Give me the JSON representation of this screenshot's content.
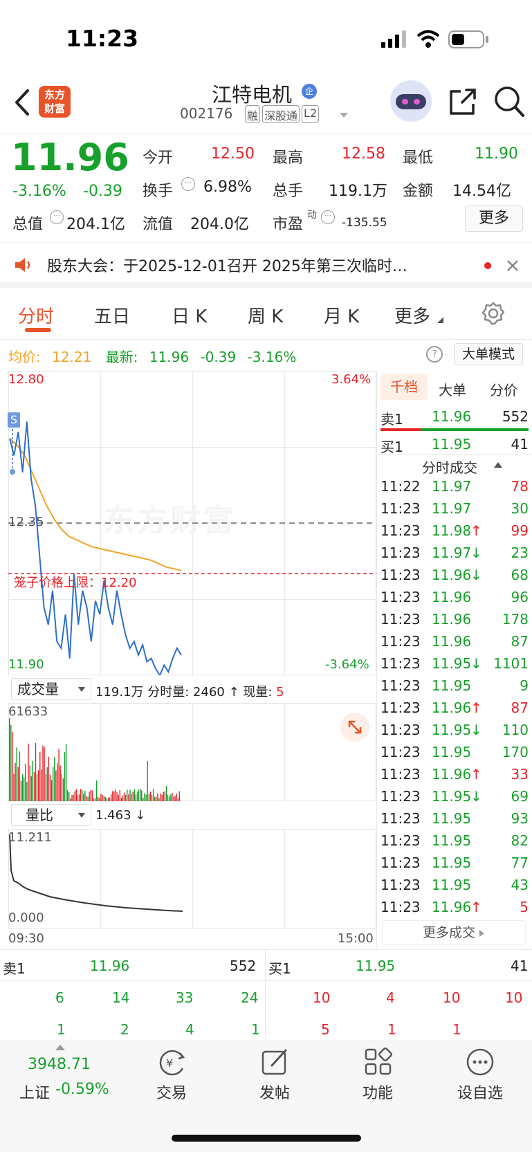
{
  "status": {
    "time": "11:23"
  },
  "header": {
    "stock_name": "江特电机",
    "stock_code": "002176",
    "badges": [
      "融",
      "深股通",
      "L2"
    ],
    "logo_line1": "东方",
    "logo_line2": "财富",
    "verified_icon": "企"
  },
  "quote": {
    "price": "11.96",
    "change_pct": "-3.16%",
    "change": "-0.39",
    "open_label": "今开",
    "open": "12.50",
    "high_label": "最高",
    "high": "12.58",
    "low_label": "最低",
    "low": "11.90",
    "turnover_label": "换手",
    "turnover": "6.98%",
    "volume_label": "总手",
    "volume": "119.1万",
    "amount_label": "金额",
    "amount": "14.54亿",
    "mktcap_label": "总值",
    "mktcap": "204.1亿",
    "float_label": "流值",
    "float": "204.0亿",
    "pe_label": "市盈",
    "pe_sup": "动",
    "pe": "-135.55",
    "more_button": "更多"
  },
  "notice": {
    "text": "股东大会：于2025-12-01召开 2025年第三次临时…"
  },
  "tabs": [
    "分时",
    "五日",
    "日 K",
    "周 K",
    "月 K",
    "更多"
  ],
  "info_line": {
    "avg_label": "均价:",
    "avg": "12.21",
    "latest_label": "最新:",
    "latest": "11.96",
    "chg": "-0.39",
    "pct": "-3.16%",
    "mode_button": "大单模式"
  },
  "chart_labels": {
    "price_top": "12.80",
    "price_mid": "12.35",
    "price_bottom": "11.90",
    "pct_top": "3.64%",
    "pct_bottom": "-3.64%",
    "s_marker": "S",
    "watermark": "东方财富",
    "limit_label": "笼子价格上限：12.20",
    "vol_select": "成交量",
    "vol_summary": "119.1万 分时量: 2460 ↑ 现量:",
    "vol_now": "5",
    "vol_max": "61633",
    "ratio_select": "量比",
    "ratio_value": "1.463 ↓",
    "ratio_max": "11.211",
    "ratio_min": "0.000",
    "time_start": "09:30",
    "time_end": "15:00"
  },
  "chart_data": {
    "type": "line",
    "x_range": [
      "09:30",
      "11:23"
    ],
    "ylim": [
      11.9,
      12.8
    ],
    "reference": 12.35,
    "price_limit_line": 12.2,
    "series": [
      {
        "values": [
          12.6,
          12.55,
          12.62,
          12.5,
          12.65,
          12.48,
          12.4,
          12.25,
          12.1,
          12.05,
          12.15,
          12.0,
          11.98,
          12.08,
          11.95,
          12.2,
          12.05,
          12.15,
          12.1,
          12.0,
          12.12,
          12.08,
          12.18,
          12.1,
          12.05,
          12.15,
          12.08,
          12.02,
          11.98,
          12.0,
          11.96,
          11.99,
          11.94,
          11.95,
          11.92,
          11.9,
          11.93,
          11.91,
          11.95,
          11.98,
          11.96
        ]
      },
      {
        "values": [
          12.6,
          12.58,
          12.55,
          12.5,
          12.45,
          12.4,
          12.36,
          12.33,
          12.31,
          12.3,
          12.29,
          12.28,
          12.275,
          12.27,
          12.265,
          12.26,
          12.255,
          12.25,
          12.245,
          12.24,
          12.23,
          12.22,
          12.215,
          12.21
        ]
      }
    ],
    "volume_max": 61633,
    "volume_ratio": {
      "max": 11.211,
      "min": 0.0,
      "current": 1.463
    }
  },
  "side": {
    "tabs": [
      "千档",
      "大单",
      "分价"
    ],
    "ask1": {
      "label": "卖1",
      "price": "11.96",
      "vol": "552"
    },
    "bid1": {
      "label": "买1",
      "price": "11.95",
      "vol": "41"
    },
    "trades_title": "分时成交",
    "trades": [
      {
        "t": "11:22",
        "p": "11.97",
        "a": "",
        "v": "78",
        "c": "red"
      },
      {
        "t": "11:23",
        "p": "11.97",
        "a": "",
        "v": "30",
        "c": "green"
      },
      {
        "t": "11:23",
        "p": "11.98",
        "a": "↑",
        "v": "99",
        "c": "red"
      },
      {
        "t": "11:23",
        "p": "11.97",
        "a": "↓",
        "v": "23",
        "c": "green"
      },
      {
        "t": "11:23",
        "p": "11.96",
        "a": "↓",
        "v": "68",
        "c": "green"
      },
      {
        "t": "11:23",
        "p": "11.96",
        "a": "",
        "v": "96",
        "c": "green"
      },
      {
        "t": "11:23",
        "p": "11.96",
        "a": "",
        "v": "178",
        "c": "green"
      },
      {
        "t": "11:23",
        "p": "11.96",
        "a": "",
        "v": "87",
        "c": "green"
      },
      {
        "t": "11:23",
        "p": "11.95",
        "a": "↓",
        "v": "1101",
        "c": "green"
      },
      {
        "t": "11:23",
        "p": "11.95",
        "a": "",
        "v": "9",
        "c": "green"
      },
      {
        "t": "11:23",
        "p": "11.96",
        "a": "↑",
        "v": "87",
        "c": "red"
      },
      {
        "t": "11:23",
        "p": "11.95",
        "a": "↓",
        "v": "110",
        "c": "green"
      },
      {
        "t": "11:23",
        "p": "11.95",
        "a": "",
        "v": "170",
        "c": "green"
      },
      {
        "t": "11:23",
        "p": "11.96",
        "a": "↑",
        "v": "33",
        "c": "red"
      },
      {
        "t": "11:23",
        "p": "11.95",
        "a": "↓",
        "v": "69",
        "c": "green"
      },
      {
        "t": "11:23",
        "p": "11.95",
        "a": "",
        "v": "93",
        "c": "green"
      },
      {
        "t": "11:23",
        "p": "11.95",
        "a": "",
        "v": "82",
        "c": "green"
      },
      {
        "t": "11:23",
        "p": "11.95",
        "a": "",
        "v": "77",
        "c": "green"
      },
      {
        "t": "11:23",
        "p": "11.95",
        "a": "",
        "v": "43",
        "c": "green"
      },
      {
        "t": "11:23",
        "p": "11.96",
        "a": "↑",
        "v": "5",
        "c": "red"
      }
    ],
    "more_trades": "更多成交"
  },
  "orderbook": {
    "ask_label": "卖1",
    "ask_price": "11.96",
    "ask_vol": "552",
    "bid_label": "买1",
    "bid_price": "11.95",
    "bid_vol": "41",
    "ask_row1": [
      "6",
      "14",
      "33",
      "24"
    ],
    "ask_row2": [
      "1",
      "2",
      "4",
      "1"
    ],
    "bid_row1": [
      "10",
      "4",
      "10",
      "10"
    ],
    "bid_row2": [
      "5",
      "1",
      "1"
    ]
  },
  "dock": {
    "index_value": "3948.71",
    "index_name": "上证",
    "index_pct": "-0.59%",
    "items": [
      "交易",
      "发帖",
      "功能",
      "设自选"
    ]
  },
  "colors": {
    "up": "#e8232a",
    "down": "#17a02b",
    "accent": "#e8542a",
    "avg_line": "#f2a326",
    "price_line": "#2e6fc9"
  }
}
